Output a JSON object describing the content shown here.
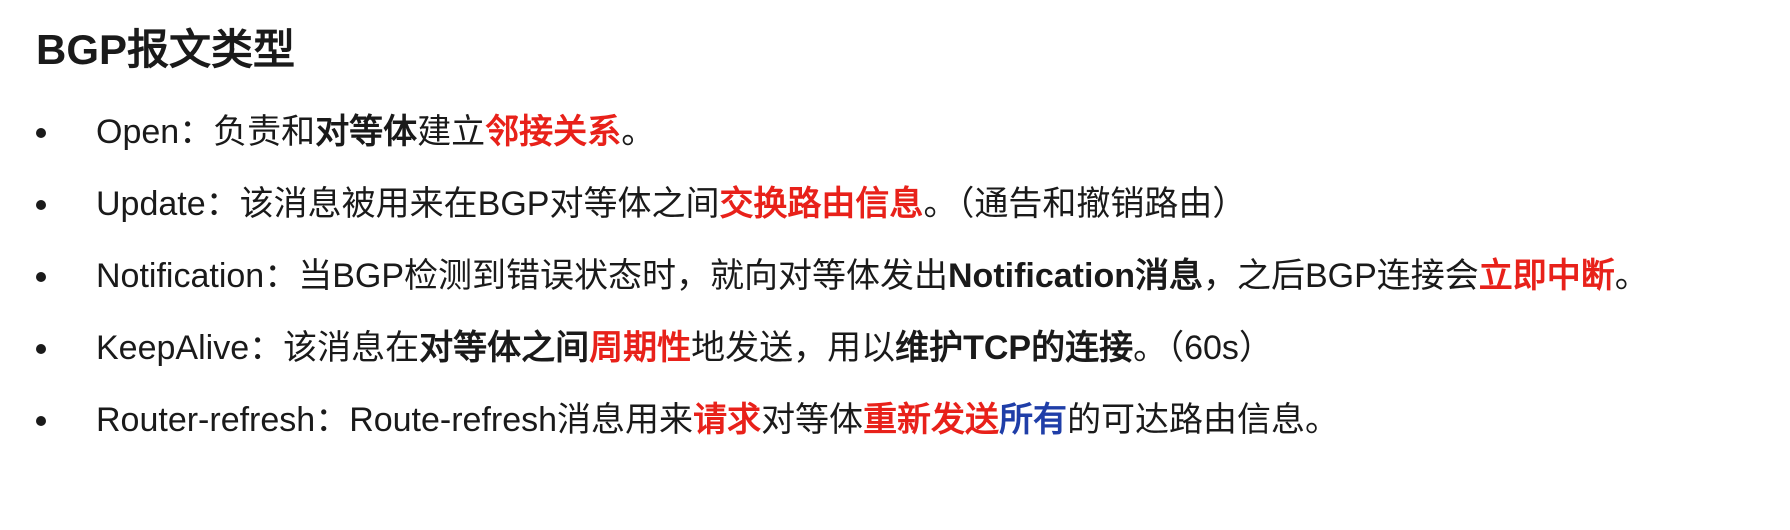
{
  "heading": "BGP报文类型",
  "colors": {
    "text": "#1a1a1a",
    "highlight_red": "#e8211a",
    "highlight_blue": "#1f3ea8"
  },
  "items": [
    {
      "segments": [
        {
          "text": "Open：负责和",
          "style": "normal"
        },
        {
          "text": "对等体",
          "style": "bold"
        },
        {
          "text": "建立",
          "style": "normal"
        },
        {
          "text": "邻接关系",
          "style": "red"
        },
        {
          "text": "。",
          "style": "normal"
        }
      ]
    },
    {
      "segments": [
        {
          "text": "Update：该消息被用来在BGP对等体之间",
          "style": "normal"
        },
        {
          "text": "交换路由信息",
          "style": "red"
        },
        {
          "text": "。（通告和撤销路由）",
          "style": "normal"
        }
      ]
    },
    {
      "segments": [
        {
          "text": "Notification：当BGP检测到错误状态时，就向对等体发出",
          "style": "normal"
        },
        {
          "text": "Notification消息",
          "style": "bold"
        },
        {
          "text": "，之后BGP连接会",
          "style": "normal"
        },
        {
          "text": "立即中断",
          "style": "red"
        },
        {
          "text": "。",
          "style": "normal"
        }
      ]
    },
    {
      "segments": [
        {
          "text": "KeepAlive：该消息在",
          "style": "normal"
        },
        {
          "text": "对等体之间",
          "style": "bold"
        },
        {
          "text": "周期性",
          "style": "red"
        },
        {
          "text": "地发送，用以",
          "style": "normal"
        },
        {
          "text": "维护TCP的连接",
          "style": "bold"
        },
        {
          "text": "。（60s）",
          "style": "normal"
        }
      ]
    },
    {
      "segments": [
        {
          "text": "Router-refresh：Route-refresh消息用来",
          "style": "normal"
        },
        {
          "text": "请求",
          "style": "red"
        },
        {
          "text": "对等体",
          "style": "normal"
        },
        {
          "text": "重新发送",
          "style": "red"
        },
        {
          "text": "所有",
          "style": "blue"
        },
        {
          "text": "的可达路由信息。",
          "style": "normal"
        }
      ]
    }
  ]
}
